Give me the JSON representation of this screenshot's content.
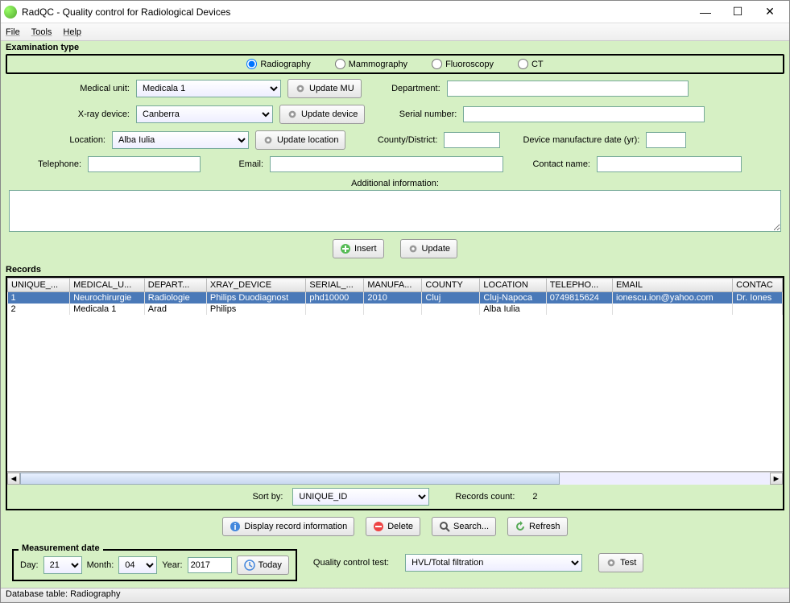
{
  "window": {
    "title": "RadQC - Quality control for Radiological Devices"
  },
  "menu": {
    "file": "File",
    "tools": "Tools",
    "help": "Help"
  },
  "exam": {
    "legend": "Examination type",
    "radiography": "Radiography",
    "mammography": "Mammography",
    "fluoroscopy": "Fluoroscopy",
    "ct": "CT"
  },
  "form": {
    "medical_unit_label": "Medical unit:",
    "medical_unit_value": "Medicala 1",
    "update_mu": "Update MU",
    "department_label": "Department:",
    "department_value": "",
    "xray_label": "X-ray device:",
    "xray_value": "Canberra",
    "update_device": "Update device",
    "serial_label": "Serial number:",
    "serial_value": "",
    "location_label": "Location:",
    "location_value": "Alba Iulia",
    "update_location": "Update location",
    "county_label": "County/District:",
    "county_value": "",
    "mfg_label": "Device manufacture date (yr):",
    "mfg_value": "",
    "telephone_label": "Telephone:",
    "telephone_value": "",
    "email_label": "Email:",
    "email_value": "",
    "contact_label": "Contact name:",
    "contact_value": "",
    "additional_label": "Additional information:",
    "insert": "Insert",
    "update": "Update"
  },
  "records": {
    "legend": "Records",
    "headers": [
      "UNIQUE_...",
      "MEDICAL_U...",
      "DEPART...",
      "XRAY_DEVICE",
      "SERIAL_...",
      "MANUFA...",
      "COUNTY",
      "LOCATION",
      "TELEPHO...",
      "EMAIL",
      "CONTAC"
    ],
    "rows": [
      {
        "c": [
          "1",
          "Neurochirurgie",
          "Radiologie",
          "Philips Duodiagnost",
          "phd10000",
          "2010",
          "Cluj",
          "Cluj-Napoca",
          "0749815624",
          "ionescu.ion@yahoo.com",
          "Dr. Iones"
        ]
      },
      {
        "c": [
          "2",
          "Medicala 1",
          "Arad",
          "Philips",
          "",
          "",
          "",
          "Alba Iulia",
          "",
          "",
          ""
        ]
      }
    ],
    "sort_label": "Sort by:",
    "sort_value": "UNIQUE_ID",
    "count_label": "Records count:",
    "count_value": "2"
  },
  "actions": {
    "display": "Display record information",
    "delete": "Delete",
    "search": "Search...",
    "refresh": "Refresh"
  },
  "meas": {
    "legend": "Measurement date",
    "day_label": "Day:",
    "day_value": "21",
    "month_label": "Month:",
    "month_value": "04",
    "year_label": "Year:",
    "year_value": "2017",
    "today": "Today"
  },
  "qc": {
    "label": "Quality control test:",
    "value": "HVL/Total filtration",
    "test": "Test"
  },
  "status": "Database table: Radiography"
}
